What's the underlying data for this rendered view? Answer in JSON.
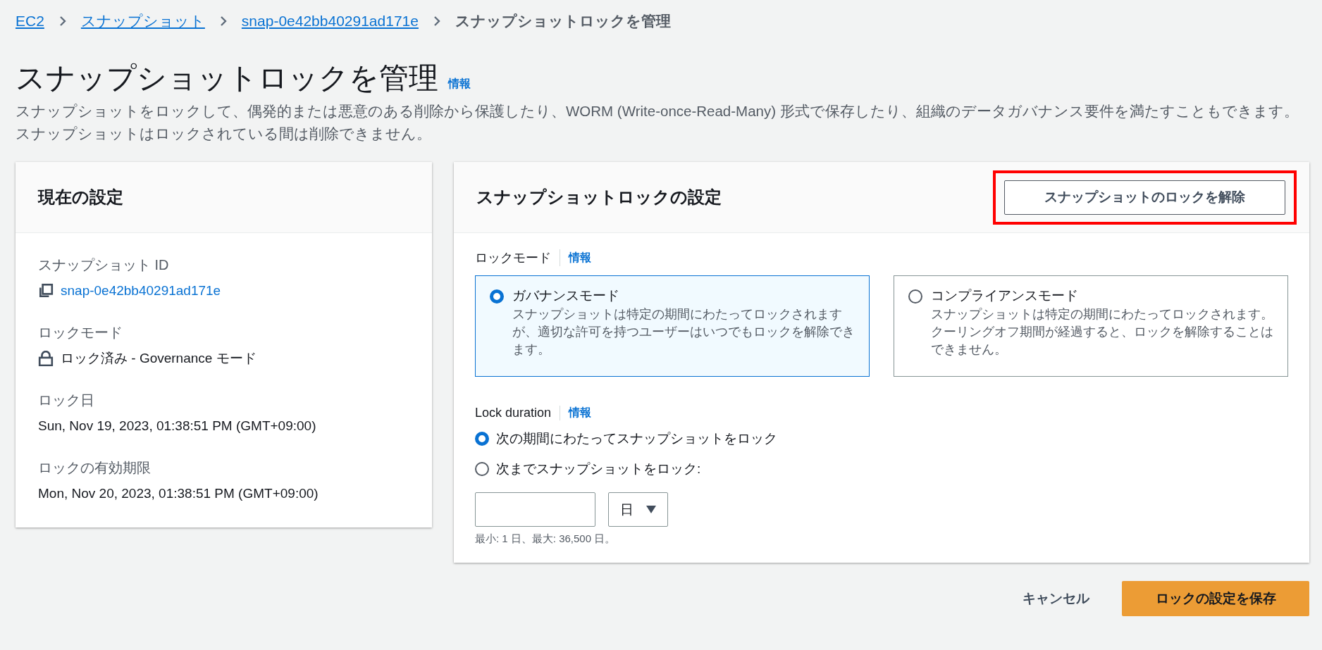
{
  "breadcrumb": [
    {
      "label": "EC2",
      "link": true
    },
    {
      "label": "スナップショット",
      "link": true
    },
    {
      "label": "snap-0e42bb40291ad171e",
      "link": true
    },
    {
      "label": "スナップショットロックを管理",
      "link": false
    }
  ],
  "page": {
    "title": "スナップショットロックを管理",
    "info": "情報",
    "description": "スナップショットをロックして、偶発的または悪意のある削除から保護したり、WORM (Write-once-Read-Many) 形式で保存したり、組織のデータガバナンス要件を満たすこともできます。スナップショットはロックされている間は削除できません。"
  },
  "current": {
    "title": "現在の設定",
    "fields": [
      {
        "kind": "copy",
        "label": "スナップショット ID",
        "value": "snap-0e42bb40291ad171e"
      },
      {
        "kind": "lock",
        "label": "ロックモード",
        "value": "ロック済み - Governance モード"
      },
      {
        "kind": "text",
        "label": "ロック日",
        "value": "Sun, Nov 19, 2023, 01:38:51 PM (GMT+09:00)"
      },
      {
        "kind": "text",
        "label": "ロックの有効期限",
        "value": "Mon, Nov 20, 2023, 01:38:51 PM (GMT+09:00)"
      }
    ]
  },
  "settings": {
    "title": "スナップショットロックの設定",
    "unlock_button": {
      "label": "スナップショットのロックを解除",
      "highlighted": true
    },
    "lock_mode": {
      "label": "ロックモード",
      "info": "情報",
      "options": [
        {
          "title": "ガバナンスモード",
          "description": "スナップショットは特定の期間にわたってロックされますが、適切な許可を持つユーザーはいつでもロックを解除できます。",
          "selected": true
        },
        {
          "title": "コンプライアンスモード",
          "description": "スナップショットは特定の期間にわたってロックされます。クーリングオフ期間が経過すると、ロックを解除することはできません。",
          "selected": false
        }
      ]
    },
    "lock_duration": {
      "label": "Lock duration",
      "info": "情報",
      "options": [
        {
          "label": "次の期間にわたってスナップショットをロック",
          "selected": true
        },
        {
          "label": "次までスナップショットをロック:",
          "selected": false
        }
      ],
      "unit": "日",
      "hint": "最小: 1 日、最大: 36,500 日。"
    }
  },
  "footer": {
    "cancel": "キャンセル",
    "save": "ロックの設定を保存"
  }
}
